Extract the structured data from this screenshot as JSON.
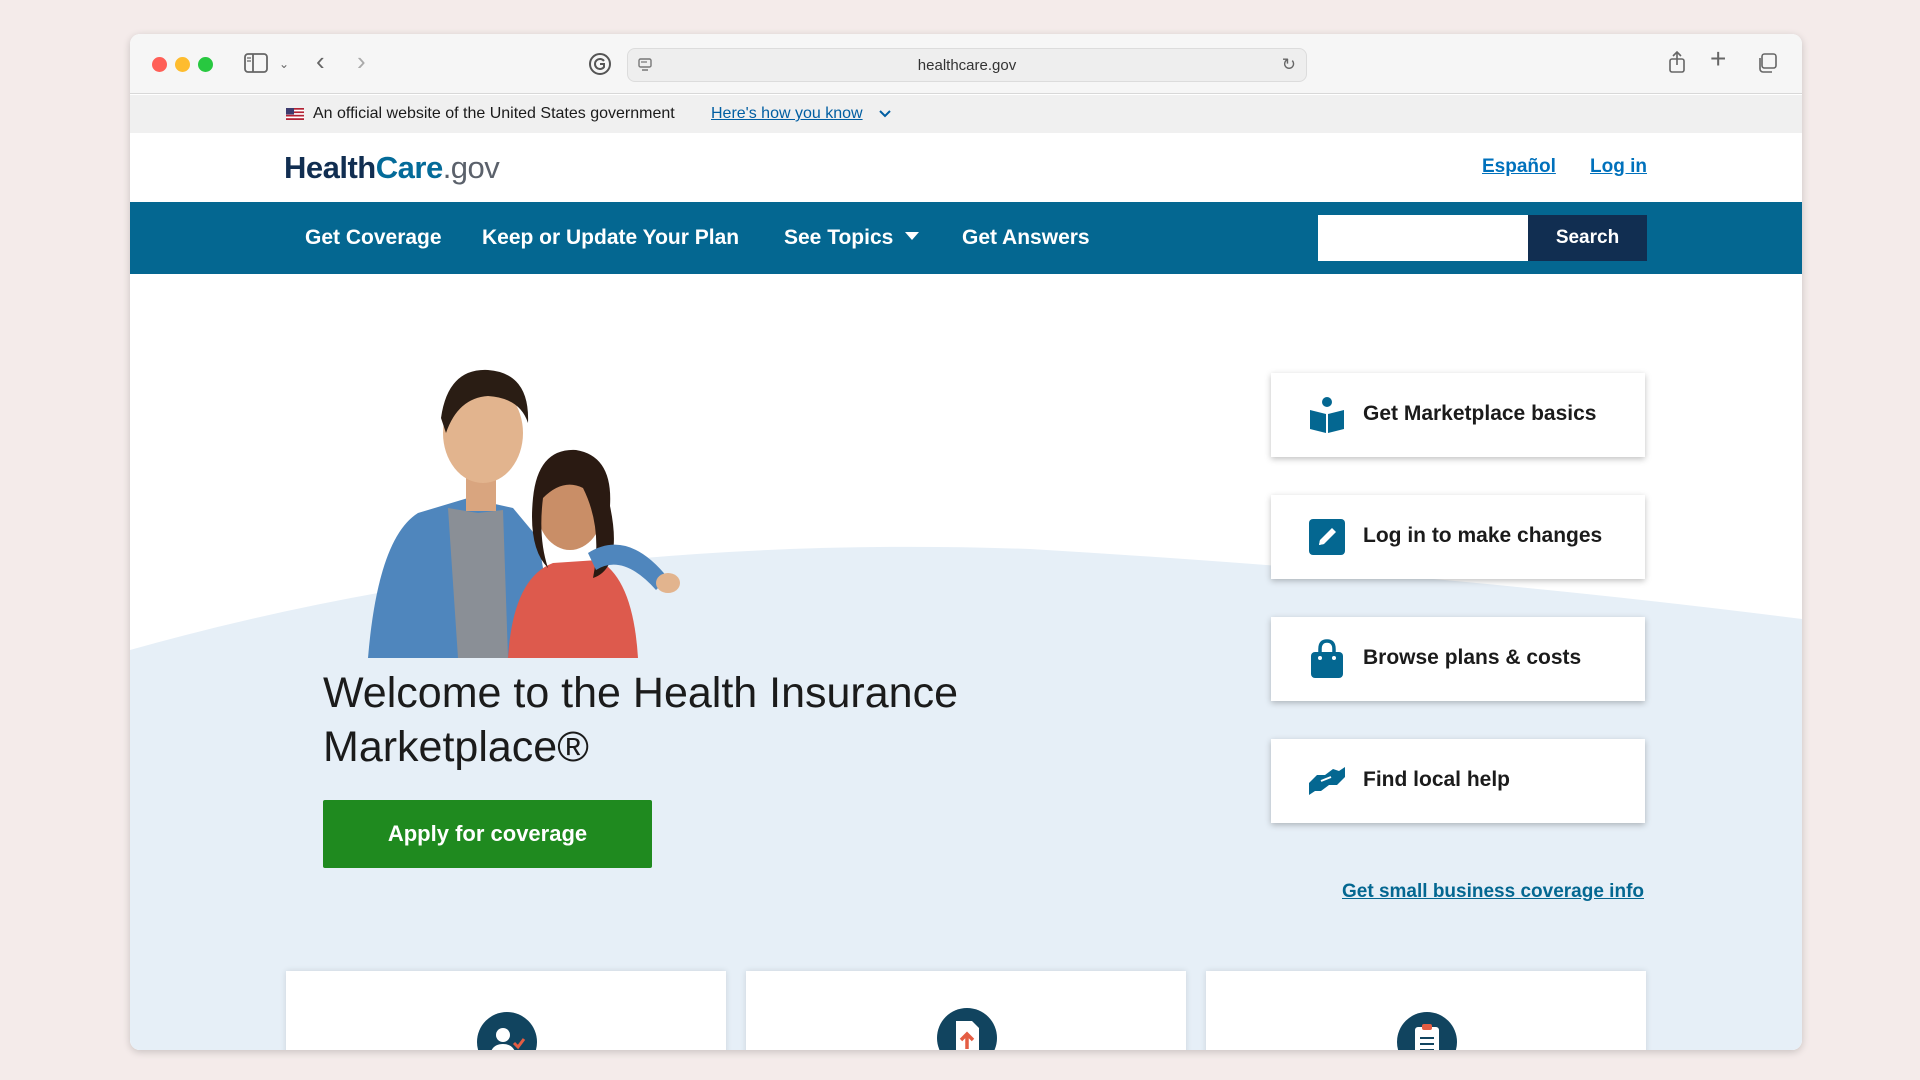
{
  "browser": {
    "url": "healthcare.gov"
  },
  "gov_banner": {
    "text": "An official website of the United States government",
    "link": "Here's how you know"
  },
  "header": {
    "logo_health": "Health",
    "logo_care": "Care",
    "logo_gov": ".gov",
    "espanol": "Español",
    "login": "Log in"
  },
  "nav": {
    "items": [
      "Get Coverage",
      "Keep or Update Your Plan",
      "See Topics",
      "Get Answers"
    ],
    "search_label": "Search",
    "search_value": ""
  },
  "hero": {
    "welcome": "Welcome to the Health Insurance Marketplace®",
    "apply": "Apply for coverage"
  },
  "actions": [
    {
      "label": "Get Marketplace basics",
      "icon": "book-reader-icon"
    },
    {
      "label": "Log in to make changes",
      "icon": "edit-pencil-icon"
    },
    {
      "label": "Browse plans & costs",
      "icon": "shopping-bag-icon"
    },
    {
      "label": "Find local help",
      "icon": "handshake-icon"
    }
  ],
  "small_business": "Get small business coverage info",
  "bottom_cards": [
    {
      "icon": "user-check-icon"
    },
    {
      "icon": "document-upload-icon"
    },
    {
      "icon": "clipboard-list-icon"
    }
  ],
  "colors": {
    "nav_blue": "#046791",
    "dark_navy": "#112e51",
    "apply_green": "#1f8a1f",
    "link_blue": "#0071bc",
    "hero_wave": "#e6eff7"
  }
}
